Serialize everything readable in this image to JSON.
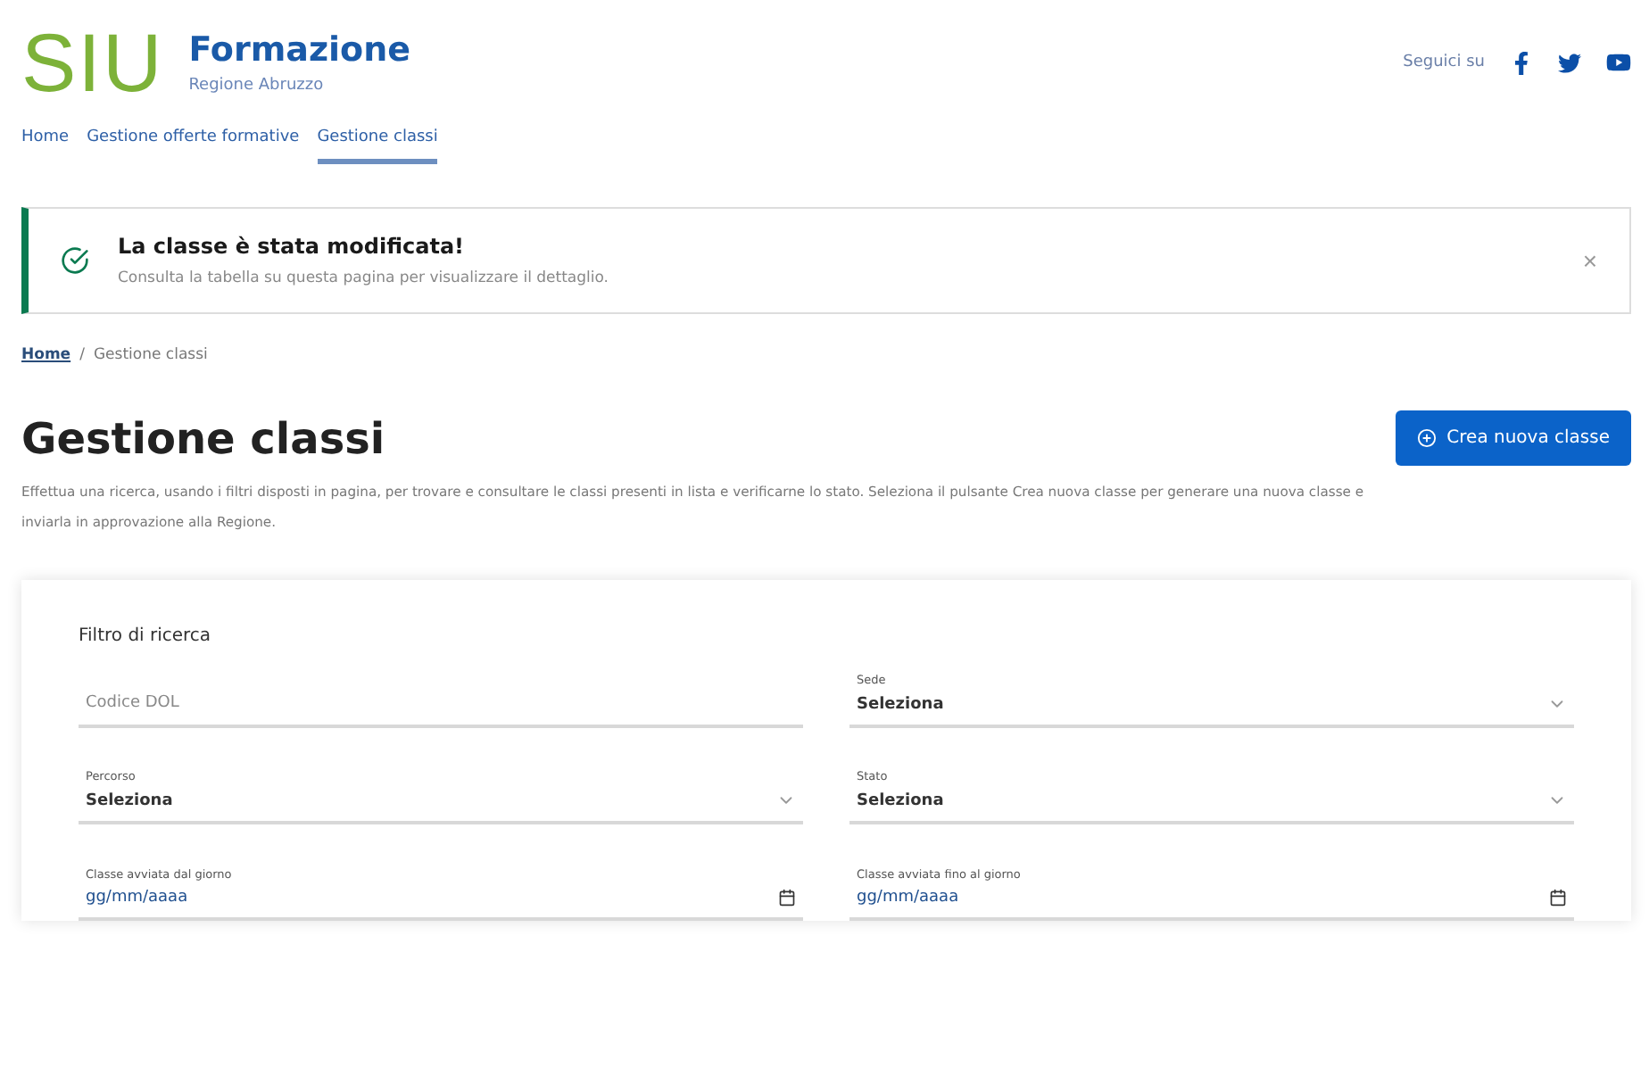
{
  "header": {
    "logo": "SIU",
    "title": "Formazione",
    "subtitle": "Regione Abruzzo",
    "social_label": "Seguici su"
  },
  "nav": [
    {
      "label": "Home",
      "selected": false
    },
    {
      "label": "Gestione offerte formative",
      "selected": false
    },
    {
      "label": "Gestione classi",
      "selected": true
    }
  ],
  "alert": {
    "title": "La classe è stata modificata!",
    "message": "Consulta la tabella su questa pagina per visualizzare il dettaglio.",
    "close": "×"
  },
  "breadcrumb_separator": "/",
  "breadcrumb": [
    {
      "label": "Home",
      "link": true
    },
    {
      "label": "Gestione classi",
      "link": false
    }
  ],
  "page_title": "Gestione classi",
  "create_button": "Crea nuova classe",
  "description": [
    "Effettua una ricerca, usando i filtri disposti in pagina, per trovare e consultare le classi presenti in lista e verificarne lo stato. Seleziona il pulsante Crea nuova classe per generare una nuova classe e",
    "inviarla in approvazione alla Regione."
  ],
  "filter": {
    "title": "Filtro di ricerca",
    "fields": [
      {
        "kind": "text",
        "placeholder": "Codice DOL"
      },
      {
        "kind": "select",
        "label": "Percorso",
        "value": "Seleziona"
      },
      {
        "kind": "date",
        "label": "Classe avviata dal giorno",
        "placeholder": "gg/mm/aaaa"
      },
      {
        "kind": "select",
        "label": "Sede",
        "value": "Seleziona"
      },
      {
        "kind": "select",
        "label": "Stato",
        "value": "Seleziona"
      },
      {
        "kind": "date",
        "label": "Classe avviata fino al giorno",
        "placeholder": "gg/mm/aaaa"
      }
    ]
  }
}
